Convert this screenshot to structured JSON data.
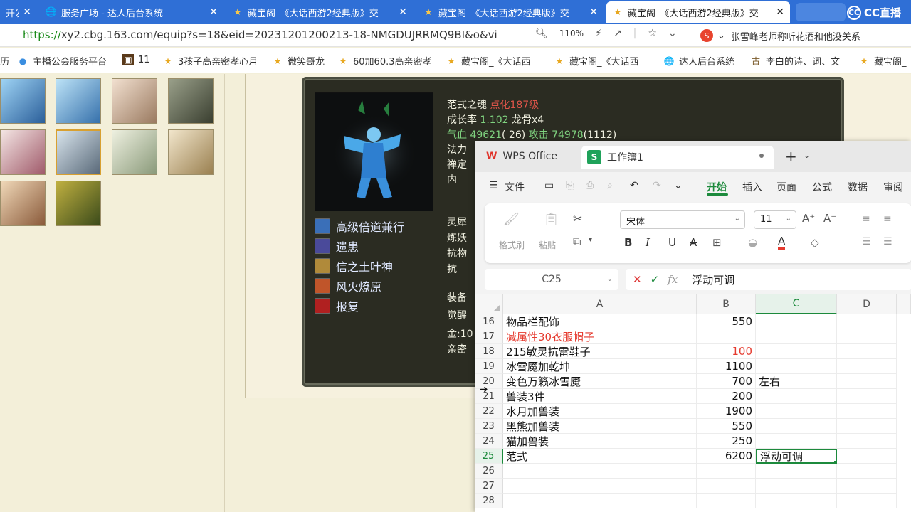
{
  "browser": {
    "tabs": [
      {
        "label": "开发",
        "icon": "doc-icon"
      },
      {
        "label": "服务广场 - 达人后台系统",
        "icon": "globe-icon"
      },
      {
        "label": "藏宝阁_《大话西游2经典版》交",
        "icon": "cbg-icon"
      },
      {
        "label": "藏宝阁_《大话西游2经典版》交",
        "icon": "cbg-icon"
      },
      {
        "label": "藏宝阁_《大话西游2经典版》交",
        "icon": "cbg-icon"
      }
    ],
    "cc_logo": "CC直播",
    "url_scheme": "https://",
    "url_rest": "xy2.cbg.163.com/equip?s=18&eid=20231201200213-18-NMGDUJRRMQ9BI&o&vi",
    "zoom": "110%",
    "search_text": "张雪峰老师称听花酒和他没关系",
    "bookmarks": [
      {
        "label": "历",
        "icon": "doc-icon"
      },
      {
        "label": "主播公会服务平台",
        "icon": "cc-icon"
      },
      {
        "label": "11",
        "icon": "game-icon"
      },
      {
        "label": "3孩子高亲密孝心月",
        "icon": "cbg-icon"
      },
      {
        "label": "微笑哥龙",
        "icon": "cbg-icon"
      },
      {
        "label": "60加60.3高亲密孝",
        "icon": "cbg-icon"
      },
      {
        "label": "藏宝阁_《大话西",
        "icon": "cbg-icon"
      },
      {
        "label": "藏宝阁_《大话西",
        "icon": "cbg-icon"
      },
      {
        "label": "达人后台系统",
        "icon": "globe-icon"
      },
      {
        "label": "李白的诗、词、文",
        "icon": "poem-icon"
      },
      {
        "label": "藏宝阁_《大话西",
        "icon": "cbg-icon"
      }
    ]
  },
  "game": {
    "name": "范式之魂",
    "level": "点化187级",
    "growth_label": "成长率",
    "growth": "1.102",
    "dragon_bone": "龙骨x4",
    "hp_label": "气血",
    "hp": "49621",
    "hp_extra": "( 26)",
    "atk_label": "攻击",
    "atk": "74978",
    "atk_extra": "(1112)",
    "partial_rows": [
      "法力",
      "禅定",
      "内"
    ],
    "partial_right": [
      "灵犀",
      "炼妖",
      "抗物",
      "抗",
      "装备",
      "觉醒",
      "金:10",
      "亲密"
    ],
    "skills": [
      {
        "label": "高级倍道兼行",
        "color": "#3a6fb8"
      },
      {
        "label": "遗患",
        "color": "#4a4a9a"
      },
      {
        "label": "信之土叶神",
        "color": "#b08a3a"
      },
      {
        "label": "风火燎原",
        "color": "#c0552a"
      },
      {
        "label": "报复",
        "color": "#b02020"
      }
    ]
  },
  "wps": {
    "app_tab": "WPS Office",
    "sheet_tab": "工作簿1",
    "menu": [
      "文件",
      "开始",
      "插入",
      "页面",
      "公式",
      "数据",
      "审阅"
    ],
    "active_menu": "开始",
    "ribbon": {
      "format_painter": "格式刷",
      "paste": "粘贴",
      "font_name": "宋体",
      "font_size": "11"
    },
    "name_box": "C25",
    "formula": "浮动可调",
    "columns": [
      "A",
      "B",
      "C",
      "D"
    ],
    "rows": [
      {
        "num": "16",
        "a": "物品栏配饰",
        "b": "550",
        "c": "",
        "a_red": false,
        "b_red": false
      },
      {
        "num": "17",
        "a": "减属性30衣服帽子",
        "b": "",
        "c": "",
        "a_red": true,
        "b_red": false
      },
      {
        "num": "18",
        "a": "215敏灵抗雷鞋子",
        "b": "100",
        "c": "",
        "a_red": false,
        "b_red": true
      },
      {
        "num": "19",
        "a": "冰雪魇加乾坤",
        "b": "1100",
        "c": "",
        "a_red": false,
        "b_red": false
      },
      {
        "num": "20",
        "a": "变色万籁冰雪魇",
        "b": "700",
        "c": "左右",
        "a_red": false,
        "b_red": false
      },
      {
        "num": "21",
        "a": "兽装3件",
        "b": "200",
        "c": "",
        "a_red": false,
        "b_red": false
      },
      {
        "num": "22",
        "a": "水月加兽装",
        "b": "1900",
        "c": "",
        "a_red": false,
        "b_red": false
      },
      {
        "num": "23",
        "a": "黑熊加兽装",
        "b": "550",
        "c": "",
        "a_red": false,
        "b_red": false
      },
      {
        "num": "24",
        "a": "猫加兽装",
        "b": "250",
        "c": "",
        "a_red": false,
        "b_red": false
      },
      {
        "num": "25",
        "a": "范式",
        "b": "6200",
        "c": "浮动可调",
        "a_red": false,
        "b_red": false
      },
      {
        "num": "26",
        "a": "",
        "b": "",
        "c": "",
        "a_red": false,
        "b_red": false
      },
      {
        "num": "27",
        "a": "",
        "b": "",
        "c": "",
        "a_red": false,
        "b_red": false
      },
      {
        "num": "28",
        "a": "",
        "b": "",
        "c": "",
        "a_red": false,
        "b_red": false
      }
    ]
  },
  "colors": {
    "browser_blue": "#2f6fd6",
    "wps_green": "#1c8a3c",
    "red_text": "#e53a2e",
    "page_bg": "#f3efd9"
  }
}
